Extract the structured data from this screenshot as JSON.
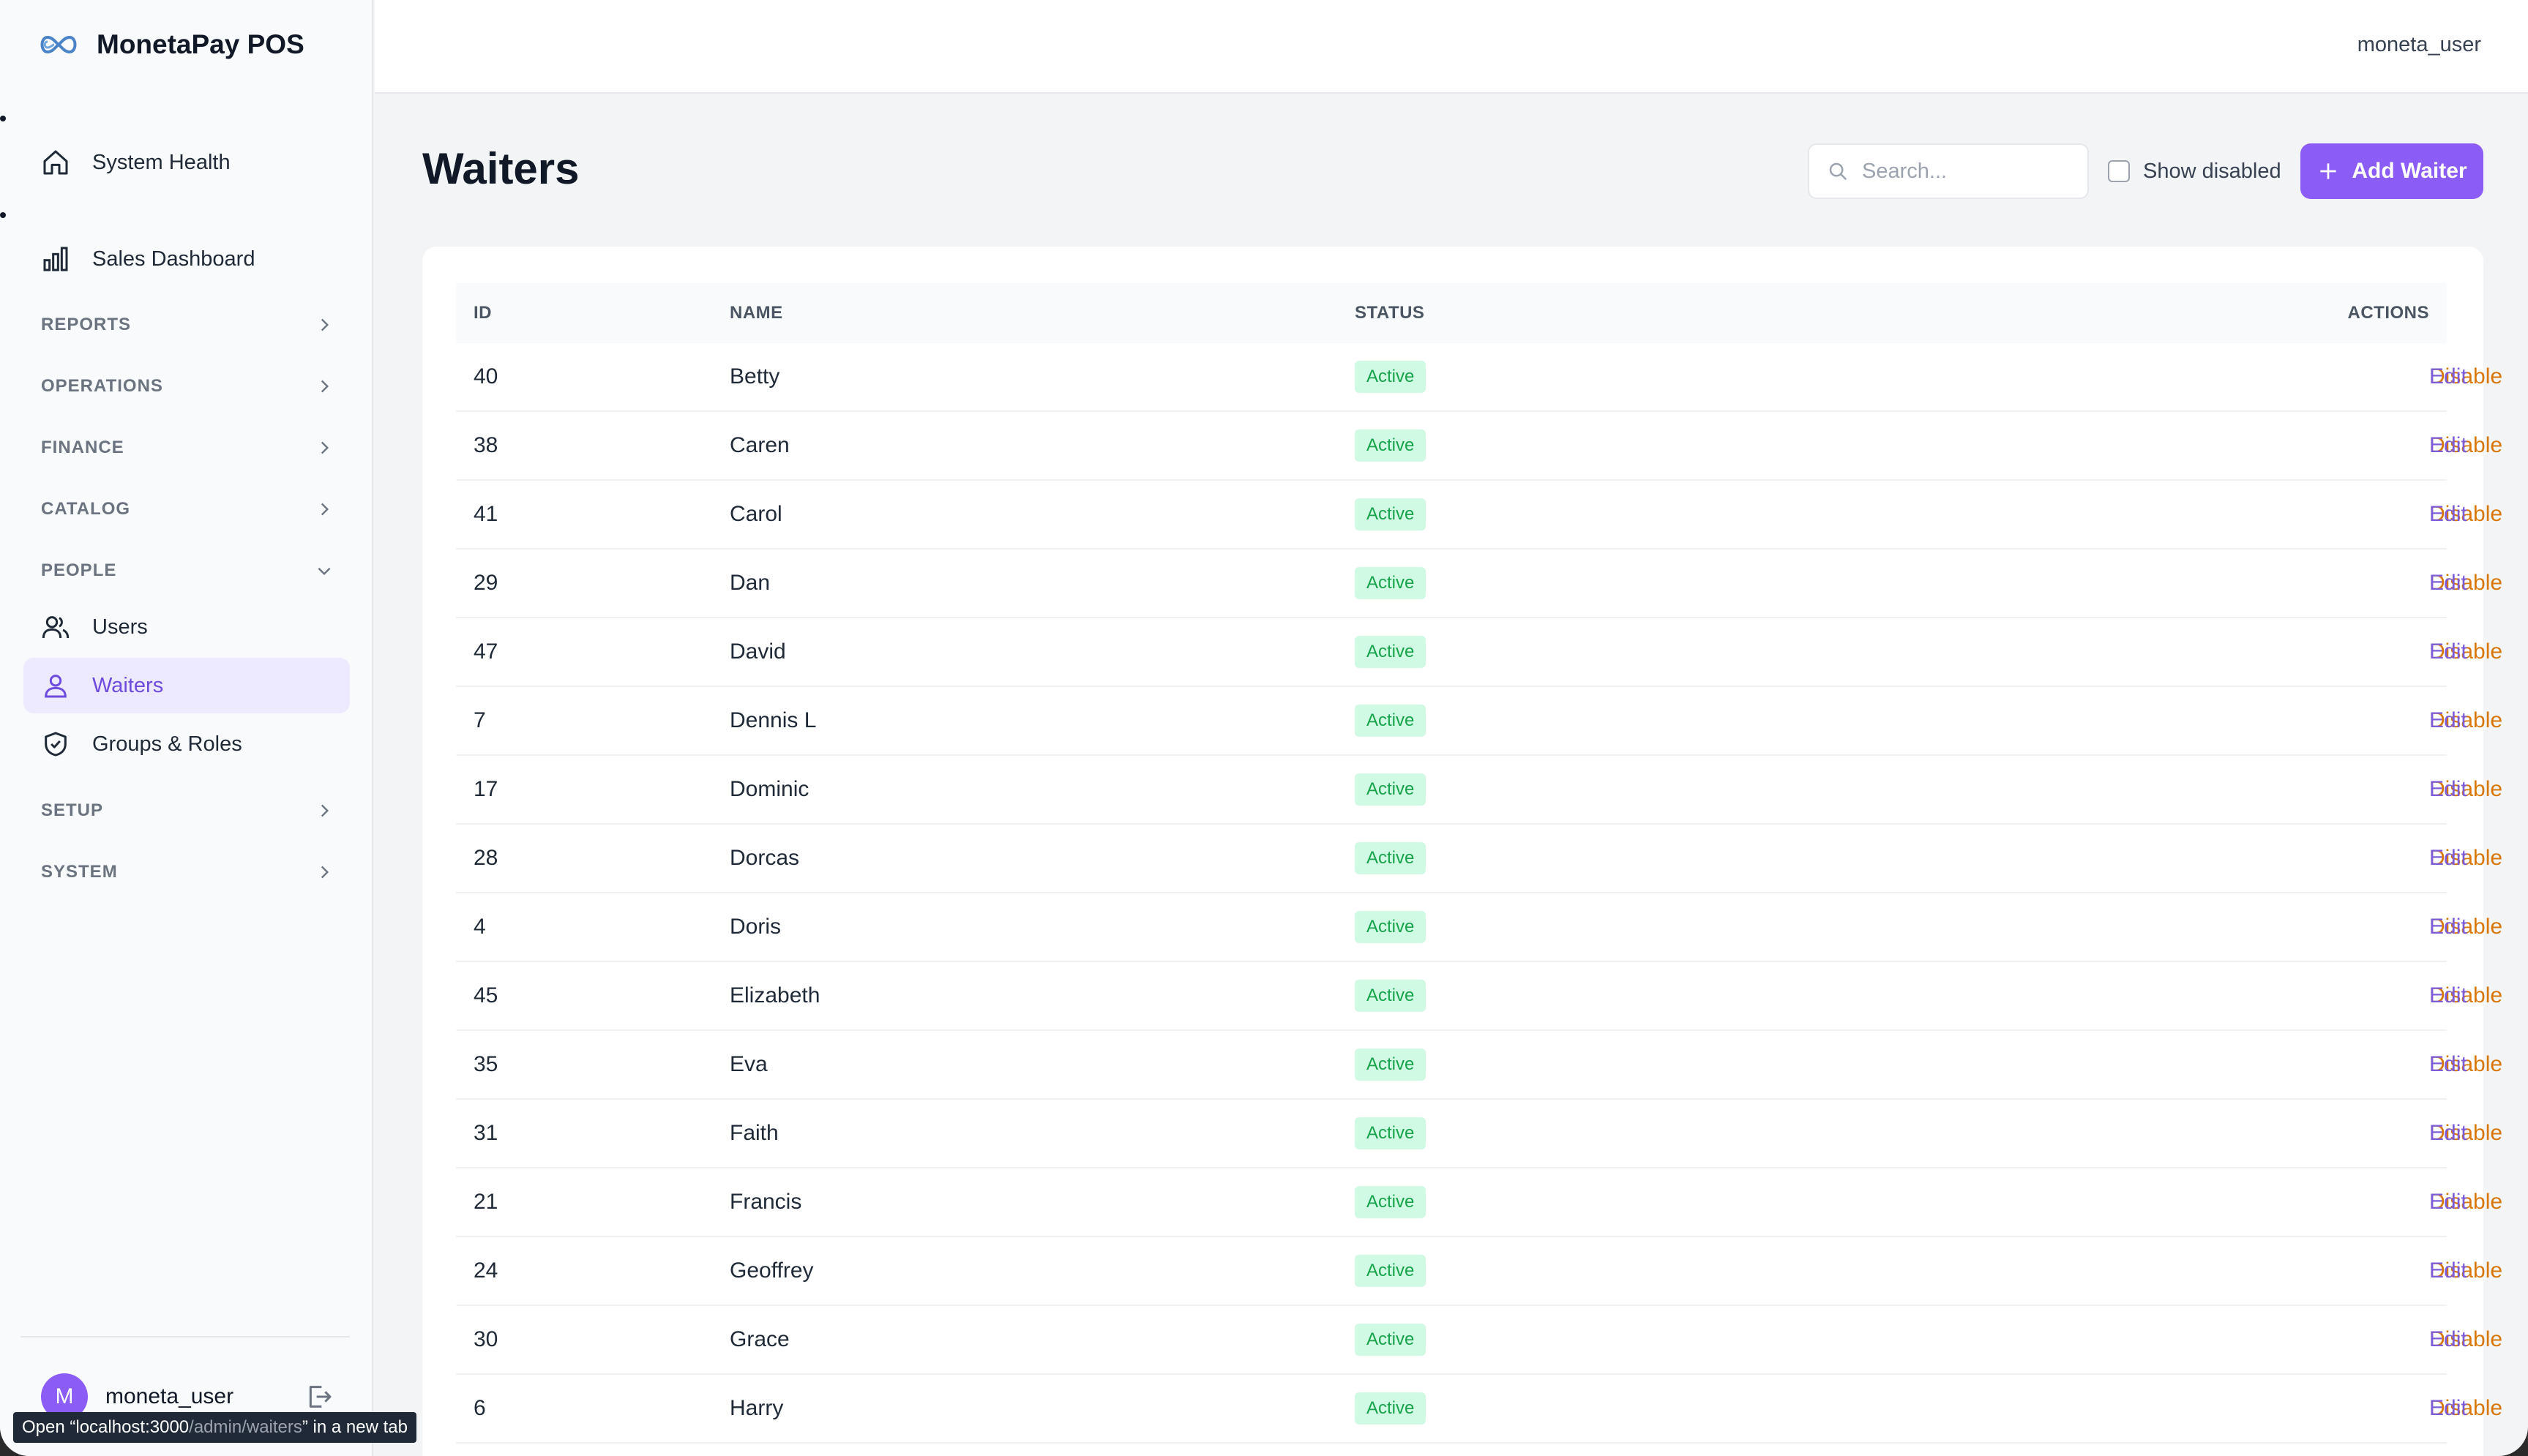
{
  "brand": {
    "name": "MonetaPay POS",
    "logo_icon": "infinity-icon"
  },
  "topbar": {
    "user": "moneta_user"
  },
  "sidebar": {
    "items": [
      {
        "label": "System Health",
        "icon": "home-icon"
      },
      {
        "label": "Sales Dashboard",
        "icon": "bar-chart-icon"
      }
    ],
    "sections": {
      "reports": "REPORTS",
      "operations": "OPERATIONS",
      "finance": "FINANCE",
      "catalog": "CATALOG",
      "people": "PEOPLE",
      "setup": "SETUP",
      "system": "SYSTEM"
    },
    "people_items": [
      {
        "label": "Users",
        "icon": "users-icon"
      },
      {
        "label": "Waiters",
        "icon": "user-icon",
        "active": true
      },
      {
        "label": "Groups & Roles",
        "icon": "shield-check-icon"
      }
    ],
    "footer": {
      "avatar_letter": "M",
      "user": "moneta_user"
    }
  },
  "tooltip": {
    "prefix": "Open “localhost:3000",
    "path": "/admin/waiters",
    "suffix": "” in a new tab"
  },
  "page": {
    "title": "Waiters",
    "search_placeholder": "Search...",
    "show_disabled_label": "Show disabled",
    "add_button_label": "Add Waiter"
  },
  "table": {
    "headers": {
      "id": "ID",
      "name": "NAME",
      "status": "STATUS",
      "actions": "ACTIONS"
    },
    "action_disable": "Disable",
    "action_edit": "Edit",
    "rows": [
      {
        "id": "40",
        "name": "Betty",
        "status": "Active"
      },
      {
        "id": "38",
        "name": "Caren",
        "status": "Active"
      },
      {
        "id": "41",
        "name": "Carol",
        "status": "Active"
      },
      {
        "id": "29",
        "name": "Dan",
        "status": "Active"
      },
      {
        "id": "47",
        "name": "David",
        "status": "Active"
      },
      {
        "id": "7",
        "name": "Dennis L",
        "status": "Active"
      },
      {
        "id": "17",
        "name": "Dominic",
        "status": "Active"
      },
      {
        "id": "28",
        "name": "Dorcas",
        "status": "Active"
      },
      {
        "id": "4",
        "name": "Doris",
        "status": "Active"
      },
      {
        "id": "45",
        "name": "Elizabeth",
        "status": "Active"
      },
      {
        "id": "35",
        "name": "Eva",
        "status": "Active"
      },
      {
        "id": "31",
        "name": "Faith",
        "status": "Active"
      },
      {
        "id": "21",
        "name": "Francis",
        "status": "Active"
      },
      {
        "id": "24",
        "name": "Geoffrey",
        "status": "Active"
      },
      {
        "id": "30",
        "name": "Grace",
        "status": "Active"
      },
      {
        "id": "6",
        "name": "Harry",
        "status": "Active"
      }
    ]
  },
  "colors": {
    "accent": "#8b5cf6",
    "disable": "#d97706",
    "active_badge_bg": "#d1fae5",
    "active_badge_fg": "#16a34a"
  }
}
